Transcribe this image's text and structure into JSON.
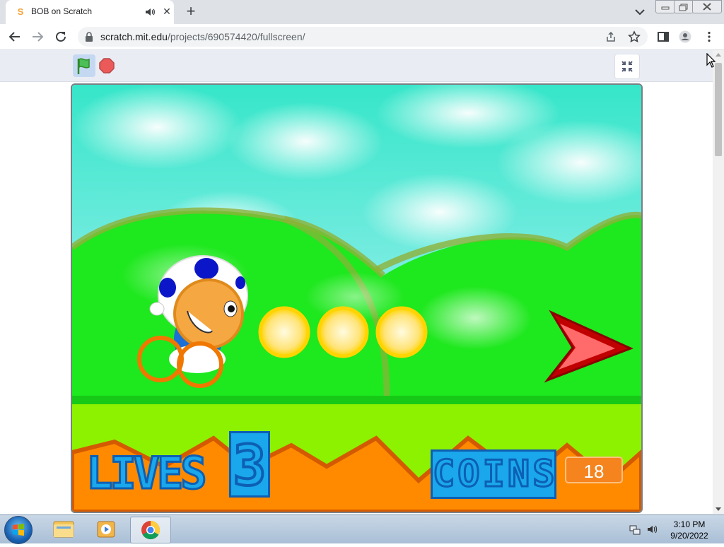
{
  "browser": {
    "tab": {
      "title": "BOB on Scratch"
    },
    "address": {
      "host": "scratch.mit.edu",
      "path": "/projects/690574420/fullscreen/"
    }
  },
  "game": {
    "lives_label": "LIVES",
    "lives_value": "3",
    "coins_label": "COINS",
    "coins_value": "18"
  },
  "taskbar": {
    "time": "3:10 PM",
    "date": "9/20/2022"
  },
  "colors": {
    "sky": "#2ee8c0",
    "grass": "#1ee81e",
    "ground": "#8cf200",
    "dirt": "#ff8a00",
    "scratch_orange": "#f5841f",
    "hud_blue": "#1aa7ec"
  },
  "icons": {
    "tab_favicon": "scratch-icon",
    "start": "windows-start-icon",
    "green_flag": "green-flag-icon",
    "stop": "stop-sign-icon",
    "exit_fullscreen": "exit-fullscreen-icon"
  }
}
